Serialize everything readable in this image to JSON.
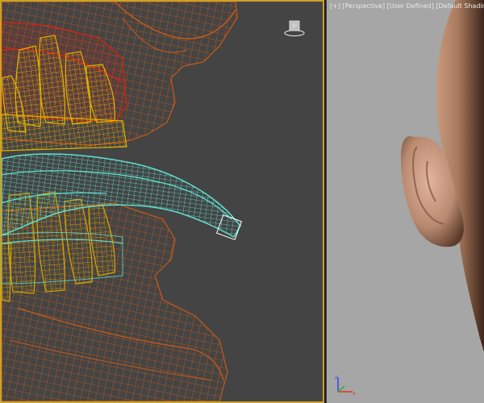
{
  "viewports": {
    "left": {
      "mode": "wireframe",
      "active": true,
      "border_color": "#c9a227",
      "background": "#444444",
      "objects": [
        {
          "name": "skull-jaw-wireframe",
          "color": "#c85a18"
        },
        {
          "name": "upper-teeth-wireframe",
          "color": "#e0b400"
        },
        {
          "name": "upper-gums-wireframe",
          "color": "#e02010"
        },
        {
          "name": "tongue-wireframe",
          "color": "#5fe0d0"
        },
        {
          "name": "lower-teeth-wireframe",
          "color": "#d4a800"
        }
      ]
    },
    "right": {
      "label": {
        "menu": "[+]",
        "view": "[Perspective]",
        "shading_a": "[User Defined]",
        "shading_b": "[Default Shading]"
      },
      "background": "#a6a6a6",
      "skin_color": "#b58a6e"
    }
  },
  "icons": {
    "viewcube": "viewcube-icon",
    "axis_tripod": "axis-tripod-icon"
  }
}
